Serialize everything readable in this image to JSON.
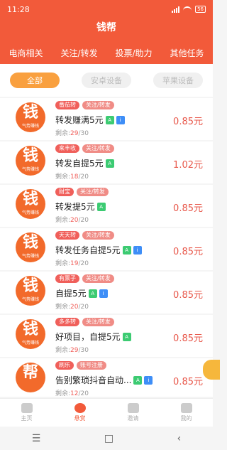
{
  "status": {
    "time": "11:28",
    "battery": "56"
  },
  "app_title": "钱帮",
  "category_tabs": [
    "电商相关",
    "关注/转发",
    "投票/助力",
    "其他任务"
  ],
  "filter_chips": [
    {
      "label": "全部",
      "active": true
    },
    {
      "label": "安卓设备",
      "active": false
    },
    {
      "label": "苹果设备",
      "active": false
    }
  ],
  "tasks": [
    {
      "logo_char": "钱",
      "logo_sub": "气势赚钱",
      "platform": "番茄转",
      "type": "关注/转发",
      "title": "转发赚满5元",
      "android": true,
      "ios": true,
      "remain_label": "剩余:",
      "remain_left": "29",
      "remain_total": "/30",
      "price": "0.85元"
    },
    {
      "logo_char": "钱",
      "logo_sub": "气势赚钱",
      "platform": "来丰收",
      "type": "关注/转发",
      "title": "转发自提5元",
      "android": true,
      "ios": false,
      "remain_label": "剩余:",
      "remain_left": "18",
      "remain_total": "/20",
      "price": "1.02元"
    },
    {
      "logo_char": "钱",
      "logo_sub": "气势赚钱",
      "platform": "财宝",
      "type": "关注/转发",
      "title": "转发提5元",
      "android": true,
      "ios": false,
      "remain_label": "剩余:",
      "remain_left": "20",
      "remain_total": "/20",
      "price": "0.85元"
    },
    {
      "logo_char": "钱",
      "logo_sub": "气势赚钱",
      "platform": "天天转",
      "type": "关注/转发",
      "title": "转发任务自提5元",
      "android": true,
      "ios": true,
      "remain_label": "剩余:",
      "remain_left": "19",
      "remain_total": "/20",
      "price": "0.85元"
    },
    {
      "logo_char": "钱",
      "logo_sub": "气势赚钱",
      "platform": "有票子",
      "type": "关注/转发",
      "title": "自提5元",
      "android": true,
      "ios": true,
      "remain_label": "剩余:",
      "remain_left": "20",
      "remain_total": "/20",
      "price": "0.85元"
    },
    {
      "logo_char": "钱",
      "logo_sub": "气势赚钱",
      "platform": "多多转",
      "type": "关注/转发",
      "title": "好项目，自提5元",
      "android": true,
      "ios": false,
      "remain_label": "剩余:",
      "remain_left": "29",
      "remain_total": "/30",
      "price": "0.85元"
    },
    {
      "logo_char": "帮",
      "logo_sub": "",
      "platform": "刷乐",
      "type": "账号注册",
      "title": "告别繁琐抖音自动...",
      "android": true,
      "ios": true,
      "remain_label": "剩余:",
      "remain_left": "12",
      "remain_total": "/20",
      "price": "0.85元"
    }
  ],
  "bottom_tabs": [
    {
      "label": "主页",
      "icon": "home-icon",
      "active": false
    },
    {
      "label": "悬赏",
      "icon": "reward-icon",
      "active": true
    },
    {
      "label": "邀请",
      "icon": "gift-icon",
      "active": false
    },
    {
      "label": "我的",
      "icon": "user-icon",
      "active": false
    }
  ],
  "nav_buttons": [
    {
      "icon": "menu-icon",
      "glyph": "☰"
    },
    {
      "icon": "home-square-icon",
      "glyph": "□"
    },
    {
      "icon": "back-icon",
      "glyph": "‹"
    }
  ],
  "colors": {
    "brand": "#f25a3a",
    "accent": "#f9a03f",
    "price": "#e8574a",
    "android": "#3ccb72",
    "ios": "#3e8ef7"
  }
}
